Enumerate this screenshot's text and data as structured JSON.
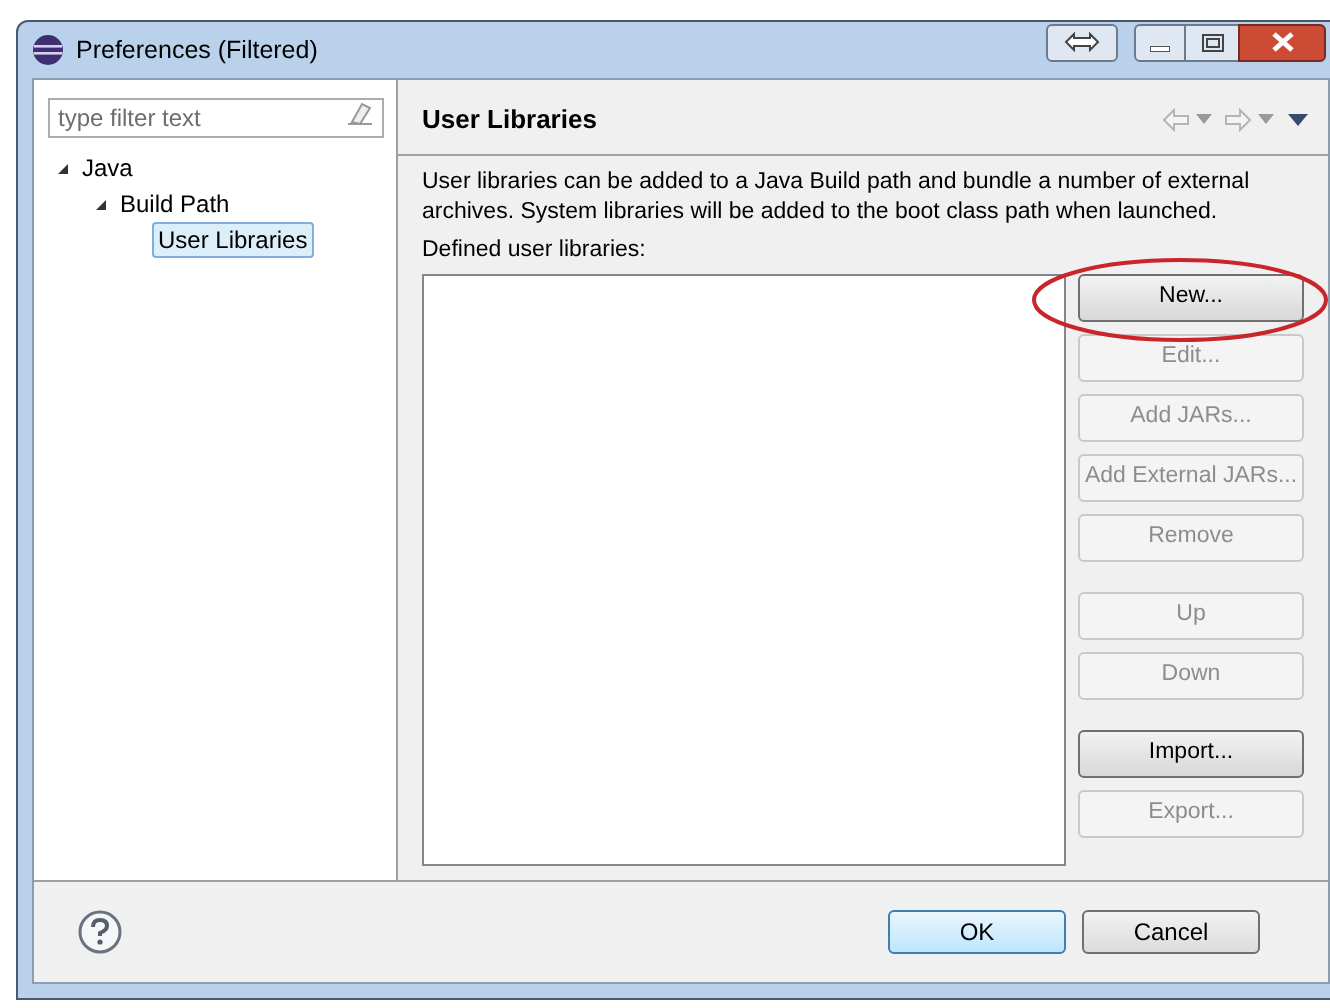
{
  "window": {
    "title": "Preferences (Filtered)"
  },
  "filter": {
    "placeholder": "type filter text"
  },
  "tree": [
    {
      "label": "Java",
      "expanded": true,
      "selected": false,
      "children": [
        {
          "label": "Build Path",
          "expanded": true,
          "selected": false,
          "children": [
            {
              "label": "User Libraries",
              "selected": true
            }
          ]
        }
      ]
    }
  ],
  "page": {
    "title": "User Libraries",
    "description": "User libraries can be added to a Java Build path and bundle a number of external archives. System libraries will be added to the boot class path when launched.",
    "list_label": "Defined user libraries:"
  },
  "button_groups": [
    [
      {
        "label": "New...",
        "disabled": false
      },
      {
        "label": "Edit...",
        "disabled": true
      },
      {
        "label": "Add JARs...",
        "disabled": true
      },
      {
        "label": "Add External JARs...",
        "disabled": true
      },
      {
        "label": "Remove",
        "disabled": true
      }
    ],
    [
      {
        "label": "Up",
        "disabled": true
      },
      {
        "label": "Down",
        "disabled": true
      }
    ],
    [
      {
        "label": "Import...",
        "disabled": false
      },
      {
        "label": "Export...",
        "disabled": true
      }
    ]
  ],
  "footer": [
    {
      "label": "OK",
      "default": true
    },
    {
      "label": "Cancel",
      "default": false
    }
  ]
}
